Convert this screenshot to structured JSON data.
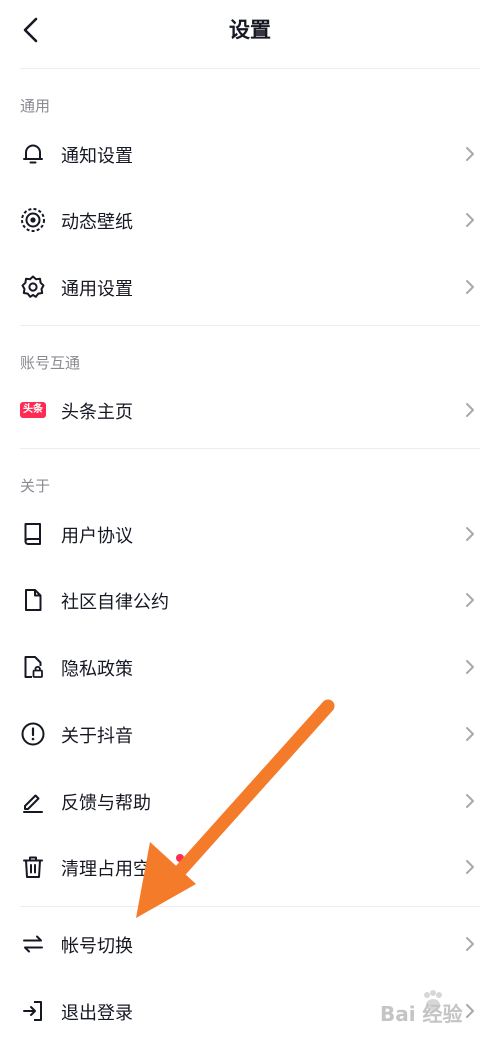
{
  "header": {
    "title": "设置"
  },
  "sections": {
    "general": {
      "label": "通用",
      "items": [
        "通知设置",
        "动态壁纸",
        "通用设置"
      ]
    },
    "account_link": {
      "label": "账号互通",
      "items": [
        "头条主页"
      ],
      "toutiao_badge": "头条"
    },
    "about": {
      "label": "关于",
      "items": [
        "用户协议",
        "社区自律公约",
        "隐私政策",
        "关于抖音",
        "反馈与帮助",
        "清理占用空间"
      ]
    },
    "account": {
      "items": [
        "帐号切换",
        "退出登录"
      ]
    }
  },
  "colors": {
    "accent_arrow": "#f47b2a",
    "badge_red": "#fe2c55",
    "text_primary": "#161823",
    "text_secondary": "#8a8b91",
    "chevron": "#a8a9ad"
  },
  "watermark": {
    "text": "Bai 经验"
  }
}
